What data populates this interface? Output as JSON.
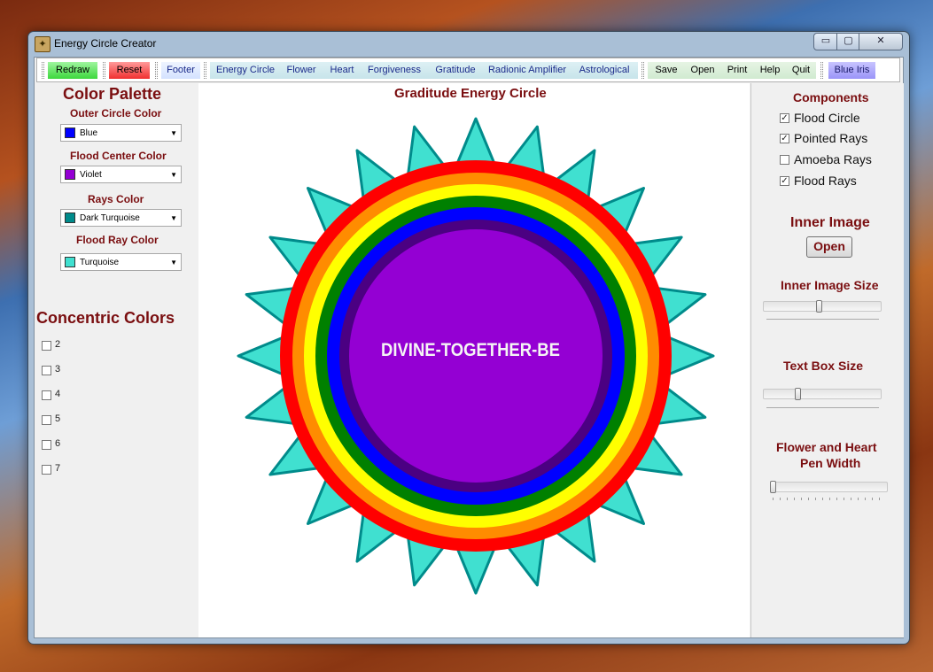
{
  "window": {
    "title": "Energy Circle Creator",
    "controls": {
      "minimize": "▭",
      "maximize": "▢",
      "close": "✕"
    }
  },
  "toolbar": {
    "redraw": "Redraw",
    "reset": "Reset",
    "footer": "Footer",
    "energy_circle": "Energy Circle",
    "flower": "Flower",
    "heart": "Heart",
    "forgiveness": "Forgiveness",
    "gratitude": "Gratitude",
    "radionic_amplifier": "Radionic Amplifier",
    "astrological": "Astrological",
    "save": "Save",
    "open": "Open",
    "print": "Print",
    "help": "Help",
    "quit": "Quit",
    "blue_iris": "Blue Iris"
  },
  "palette": {
    "title": "Color Palette",
    "outer_circle": {
      "label": "Outer Circle Color",
      "value": "Blue",
      "swatch": "#0000ff"
    },
    "flood_center": {
      "label": "Flood Center Color",
      "value": "Violet",
      "swatch": "#9400d3"
    },
    "rays": {
      "label": "Rays Color",
      "value": "Dark Turquoise",
      "swatch": "#008b8b"
    },
    "flood_ray": {
      "label": "Flood Ray Color",
      "value": "Turquoise",
      "swatch": "#40e0d0"
    }
  },
  "concentric": {
    "title": "Concentric Colors",
    "options": [
      {
        "label": "2",
        "checked": false
      },
      {
        "label": "3",
        "checked": false
      },
      {
        "label": "4",
        "checked": false
      },
      {
        "label": "5",
        "checked": false
      },
      {
        "label": "6",
        "checked": false
      },
      {
        "label": "7",
        "checked": false
      }
    ]
  },
  "canvas": {
    "title": "Graditude Energy Circle",
    "center_text": "DIVINE-TOGETHER-BE",
    "rings": [
      "#ff0000",
      "#ff8c00",
      "#ffff00",
      "#008000",
      "#0000ff",
      "#4b0082",
      "#9400d3"
    ],
    "ray_fill": "#40e0d0",
    "ray_stroke": "#008b8b"
  },
  "components": {
    "title": "Components",
    "items": [
      {
        "label": "Flood Circle",
        "checked": true
      },
      {
        "label": "Pointed Rays",
        "checked": true
      },
      {
        "label": "Amoeba Rays",
        "checked": false
      },
      {
        "label": "Flood Rays",
        "checked": true
      }
    ]
  },
  "inner_image": {
    "title": "Inner Image",
    "open_label": "Open"
  },
  "inner_image_size": {
    "title": "Inner Image Size",
    "level": 0.47
  },
  "text_box_size": {
    "title": "Text Box Size",
    "level": 0.28
  },
  "pen_width": {
    "title_line1": "Flower and Heart",
    "title_line2": "Pen Width",
    "level": 0.0
  }
}
